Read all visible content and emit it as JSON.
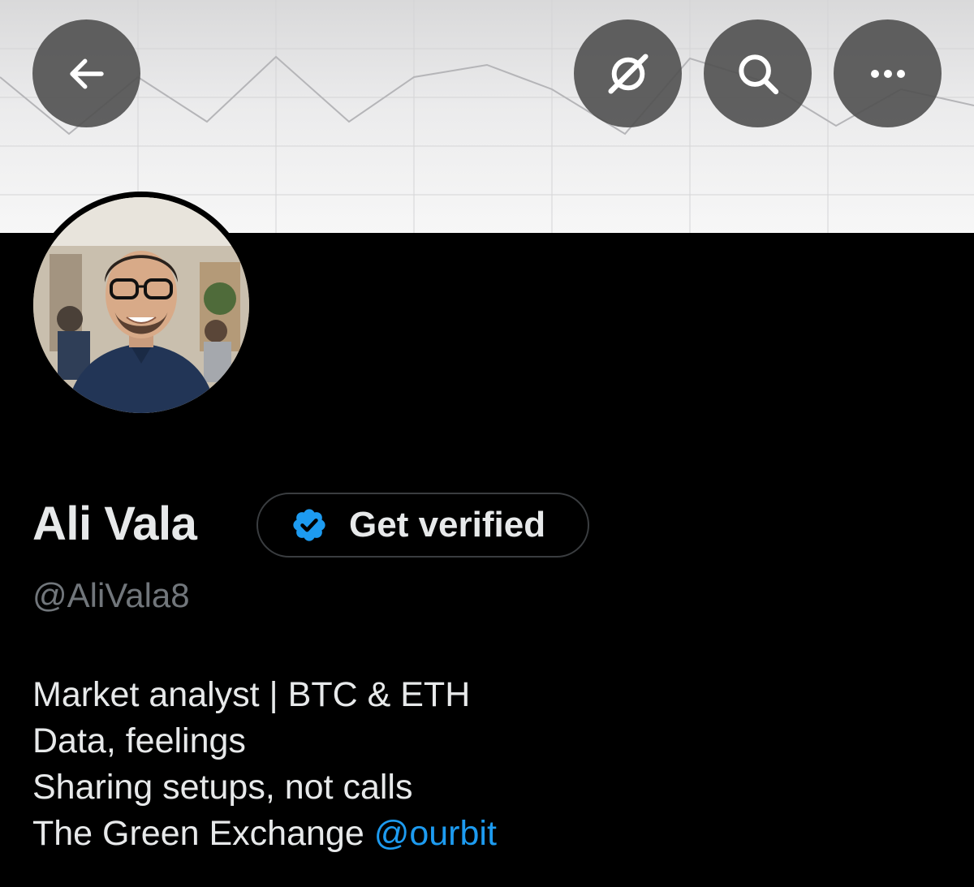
{
  "header": {
    "back_icon": "arrow-left-icon",
    "grok_icon": "grok-icon",
    "search_icon": "search-icon",
    "more_icon": "more-horizontal-icon",
    "button_color": "#505050"
  },
  "profile": {
    "display_name": "Ali Vala",
    "handle": "@AliVala8",
    "verify_button_label": "Get verified",
    "verify_icon": "verified-badge-icon",
    "verified_color": "#1d9bf0",
    "bio": {
      "line1": "Market analyst | BTC & ETH",
      "line2": "Data, feelings",
      "line3": "Sharing setups, not calls",
      "line4_text": "The Green Exchange ",
      "line4_mention": "@ourbit"
    }
  },
  "colors": {
    "background": "#000000",
    "text_primary": "#e7e9ea",
    "text_secondary": "#71767b",
    "link": "#1d9bf0"
  }
}
